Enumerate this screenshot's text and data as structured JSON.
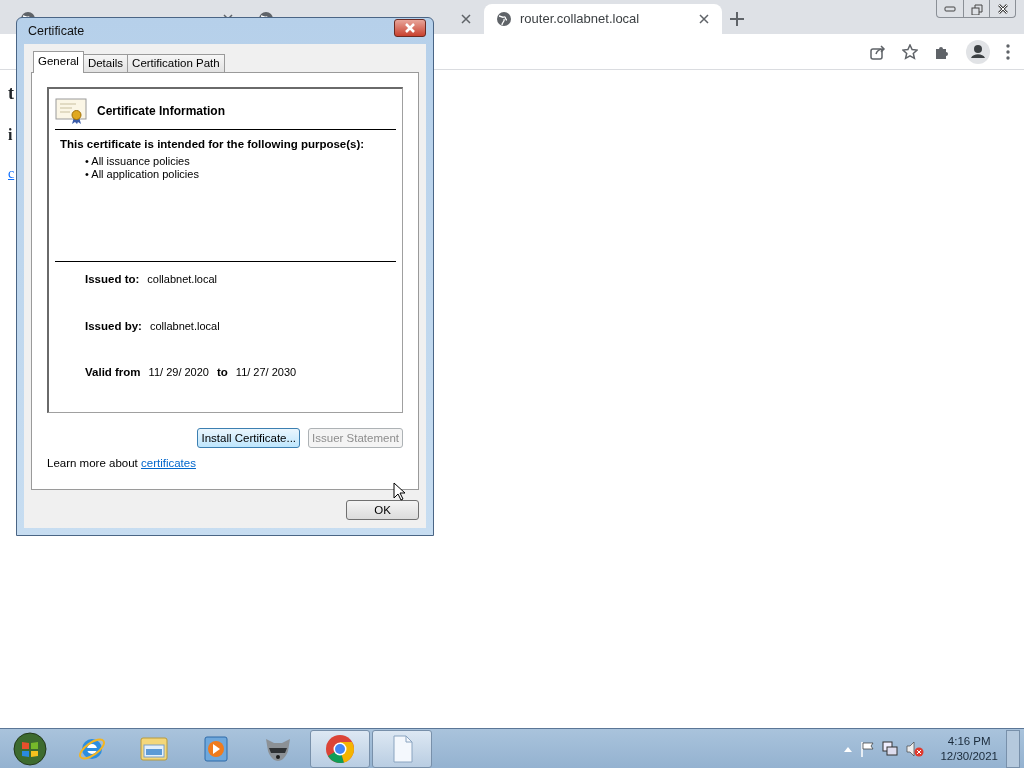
{
  "browser": {
    "tabs": [
      {
        "selected": false
      },
      {
        "selected": false
      },
      {
        "title": "router.collabnet.local",
        "selected": true
      }
    ]
  },
  "page": {
    "heading": "t",
    "text": "i",
    "link": "c"
  },
  "dialog": {
    "title": "Certificate",
    "tabs": [
      {
        "label": "General",
        "selected": true
      },
      {
        "label": "Details",
        "selected": false
      },
      {
        "label": "Certification Path",
        "selected": false
      }
    ],
    "header": "Certificate Information",
    "purpose_title": "This certificate is intended for the following purpose(s):",
    "purposes": [
      "• All issuance policies",
      "• All application policies"
    ],
    "issued_to_label": "Issued to:",
    "issued_to": "collabnet.local",
    "issued_by_label": "Issued by:",
    "issued_by": "collabnet.local",
    "valid_from_label": "Valid from",
    "valid_from": "11/ 29/ 2020",
    "to_label": "to",
    "valid_to": "11/ 27/ 2030",
    "buttons": [
      {
        "label": "Install Certificate...",
        "focused": true,
        "disabled": false
      },
      {
        "label": "Issuer Statement",
        "focused": false,
        "disabled": true
      }
    ],
    "learn_more": "Learn more about",
    "learn_more_link": "certificates",
    "ok": "OK"
  },
  "taskbar": {
    "apps": [
      {
        "kind": "ie",
        "open": false
      },
      {
        "kind": "explorer",
        "open": false
      },
      {
        "kind": "media",
        "open": false
      },
      {
        "kind": "animal",
        "open": false
      },
      {
        "kind": "chrome",
        "open": true
      },
      {
        "kind": "document",
        "open": true
      }
    ],
    "clock_time": "4:16 PM",
    "clock_date": "12/30/2021"
  }
}
